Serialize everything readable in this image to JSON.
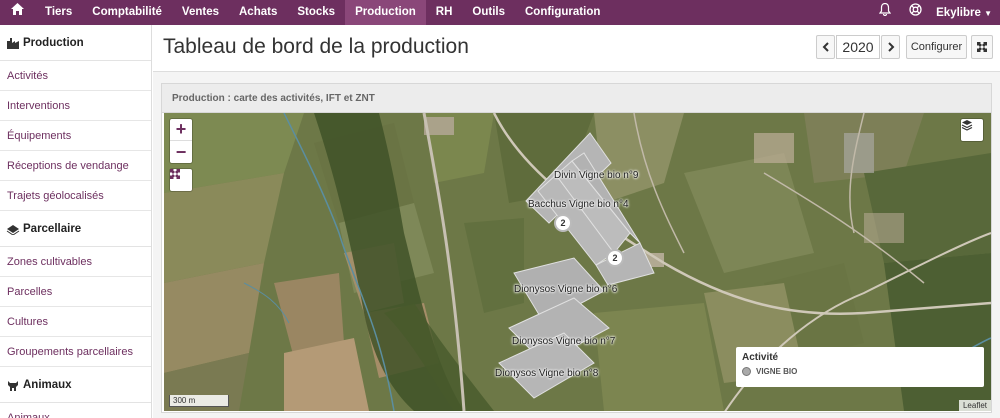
{
  "nav": {
    "home_icon": "home-icon",
    "items": [
      "Tiers",
      "Comptabilité",
      "Ventes",
      "Achats",
      "Stocks",
      "Production",
      "RH",
      "Outils",
      "Configuration"
    ],
    "active": "Production",
    "notifications_icon": "bell-icon",
    "help_icon": "lifebuoy-icon",
    "user": "Ekylibre",
    "accent_color": "#6d2f5f"
  },
  "sidebar": {
    "sections": [
      {
        "title": "Production",
        "icon": "factory-icon",
        "items": [
          "Activités",
          "Interventions",
          "Équipements",
          "Réceptions de vendange",
          "Trajets géolocalisés"
        ]
      },
      {
        "title": "Parcellaire",
        "icon": "parcel-icon",
        "items": [
          "Zones cultivables",
          "Parcelles",
          "Cultures",
          "Groupements parcellaires"
        ]
      },
      {
        "title": "Animaux",
        "icon": "cow-icon",
        "items": [
          "Animaux"
        ]
      }
    ]
  },
  "header": {
    "title": "Tableau de bord de la production",
    "year": "2020",
    "configure_label": "Configurer",
    "prev_icon": "chevron-left-icon",
    "next_icon": "chevron-right-icon",
    "fullscreen_icon": "expand-icon"
  },
  "panel": {
    "title": "Production : carte des activités, IFT et ZNT"
  },
  "map": {
    "plots": [
      "Divin Vigne bio n°9",
      "Bacchus Vigne bio n°4",
      "Dionysos Vigne bio n°6",
      "Dionysos Vigne bio n°7",
      "Dionysos Vigne bio n°8"
    ],
    "clusters": [
      "2",
      "2"
    ],
    "legend": {
      "title": "Activité",
      "items": [
        {
          "label": "VIGNE BIO",
          "color": "#aaaaaa"
        }
      ]
    },
    "scale": "300 m",
    "attribution": "Leaflet"
  }
}
